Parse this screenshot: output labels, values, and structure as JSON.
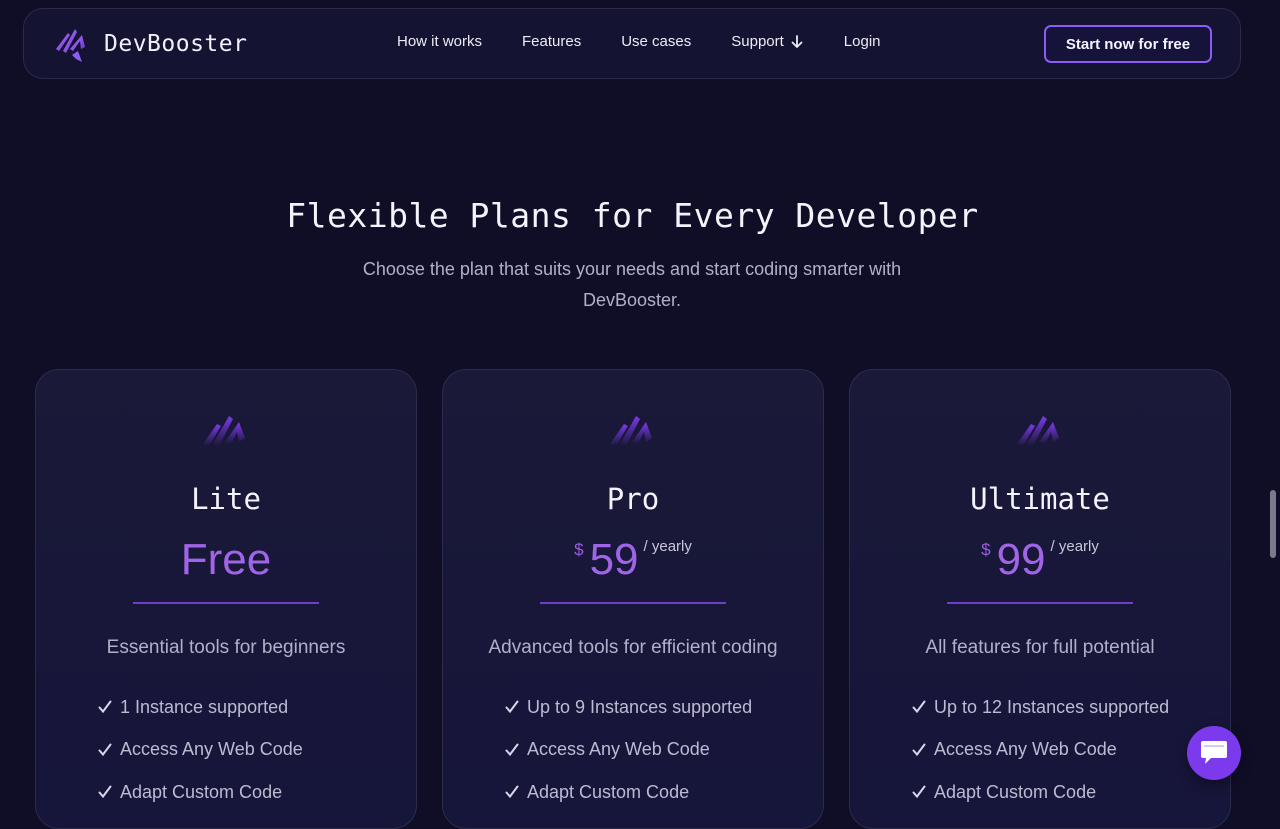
{
  "colors": {
    "background": "#0f0e26",
    "accent": "#8b5cf6",
    "price": "#a064e6"
  },
  "brand": {
    "name": "DevBooster",
    "logo": "devbooster-logo-icon"
  },
  "nav": {
    "links": [
      "How it works",
      "Features",
      "Use cases",
      "Support",
      "Login"
    ],
    "support_icon": "arrow-down-icon",
    "cta": "Start now for free"
  },
  "hero": {
    "title": "Flexible Plans for Every Developer",
    "subtitle": "Choose the plan that suits your needs and start coding smarter with DevBooster."
  },
  "plans": [
    {
      "name": "Lite",
      "price": "Free",
      "description": "Essential tools for beginners",
      "features": [
        "1 Instance supported",
        "Access Any Web Code",
        "Adapt Custom Code"
      ]
    },
    {
      "name": "Pro",
      "currency": "$",
      "price": "59",
      "period": "/ yearly",
      "description": "Advanced tools for efficient coding",
      "features": [
        "Up to 9 Instances supported",
        "Access Any Web Code",
        "Adapt Custom Code"
      ]
    },
    {
      "name": "Ultimate",
      "currency": "$",
      "price": "99",
      "period": "/ yearly",
      "description": "All features for full potential",
      "features": [
        "Up to 12 Instances supported",
        "Access Any Web Code",
        "Adapt Custom Code"
      ]
    }
  ],
  "chat": {
    "icon": "chat-icon"
  }
}
